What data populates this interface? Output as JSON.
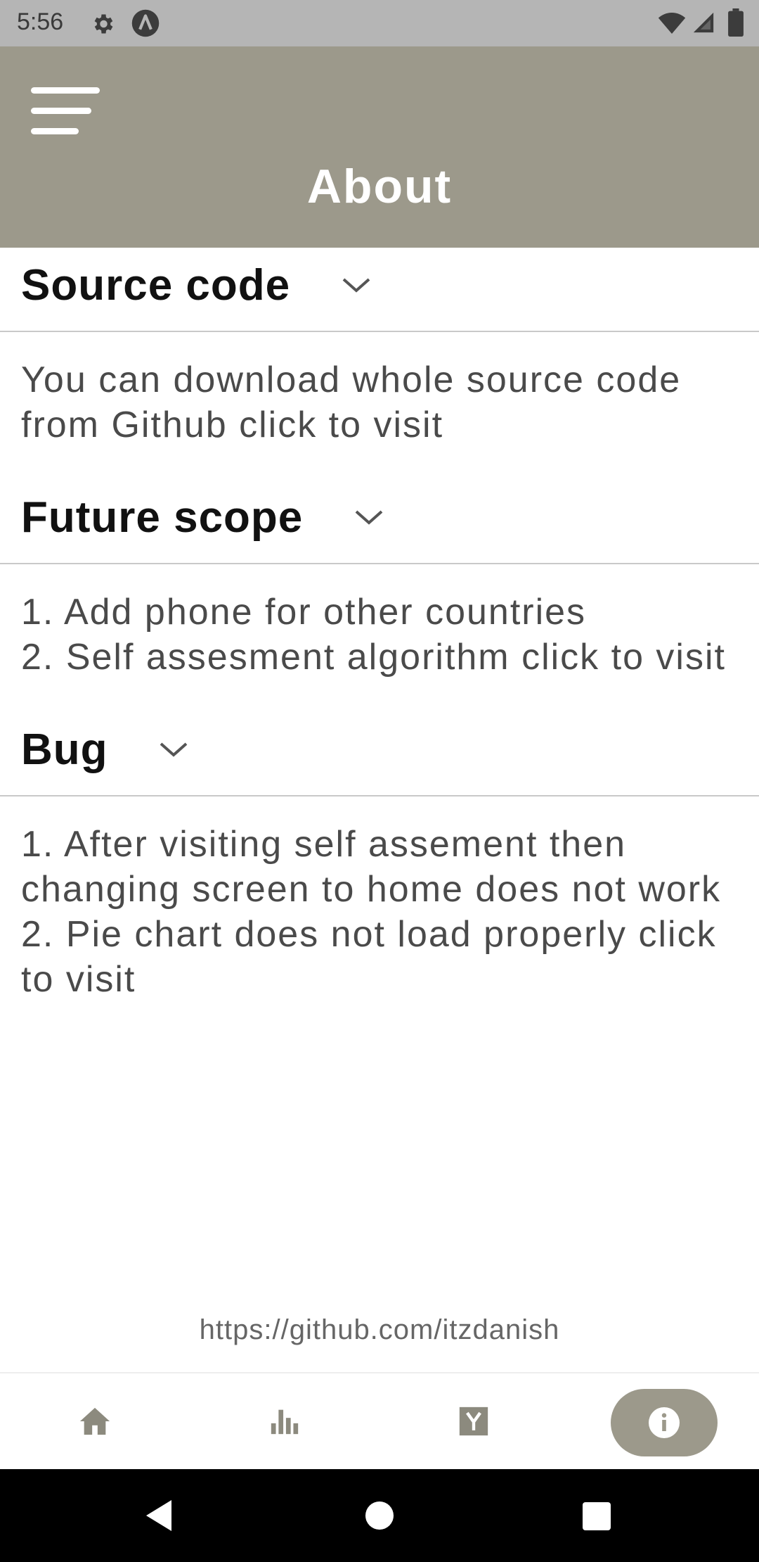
{
  "status_bar": {
    "time": "5:56",
    "icons": [
      "gear-icon",
      "a-circle-icon",
      "wifi-icon",
      "signal-icon",
      "battery-icon"
    ]
  },
  "app_bar": {
    "title": "About",
    "menu_icon": "hamburger-menu-icon",
    "background": "#9c998b"
  },
  "sections": [
    {
      "title": "Source code",
      "lines": [
        "You can download whole source code from Github click to visit"
      ]
    },
    {
      "title": "Future scope",
      "lines": [
        "1. Add phone for other countries",
        "2. Self assesment algorithm click to visit"
      ]
    },
    {
      "title": "Bug",
      "lines": [
        "1. After visiting self assement then changing screen to home does not work",
        "2. Pie chart does not load properly click to visit"
      ]
    }
  ],
  "footer": {
    "link": "https://github.com/itzdanish"
  },
  "bottom_nav": {
    "items": [
      "home-icon",
      "bar-chart-icon",
      "y-square-icon",
      "info-icon"
    ],
    "active_index": 3,
    "active_color": "#9c998b",
    "icon_color": "#8c8a7e"
  },
  "system_nav": [
    "back-icon",
    "home-circle-icon",
    "recents-square-icon"
  ]
}
